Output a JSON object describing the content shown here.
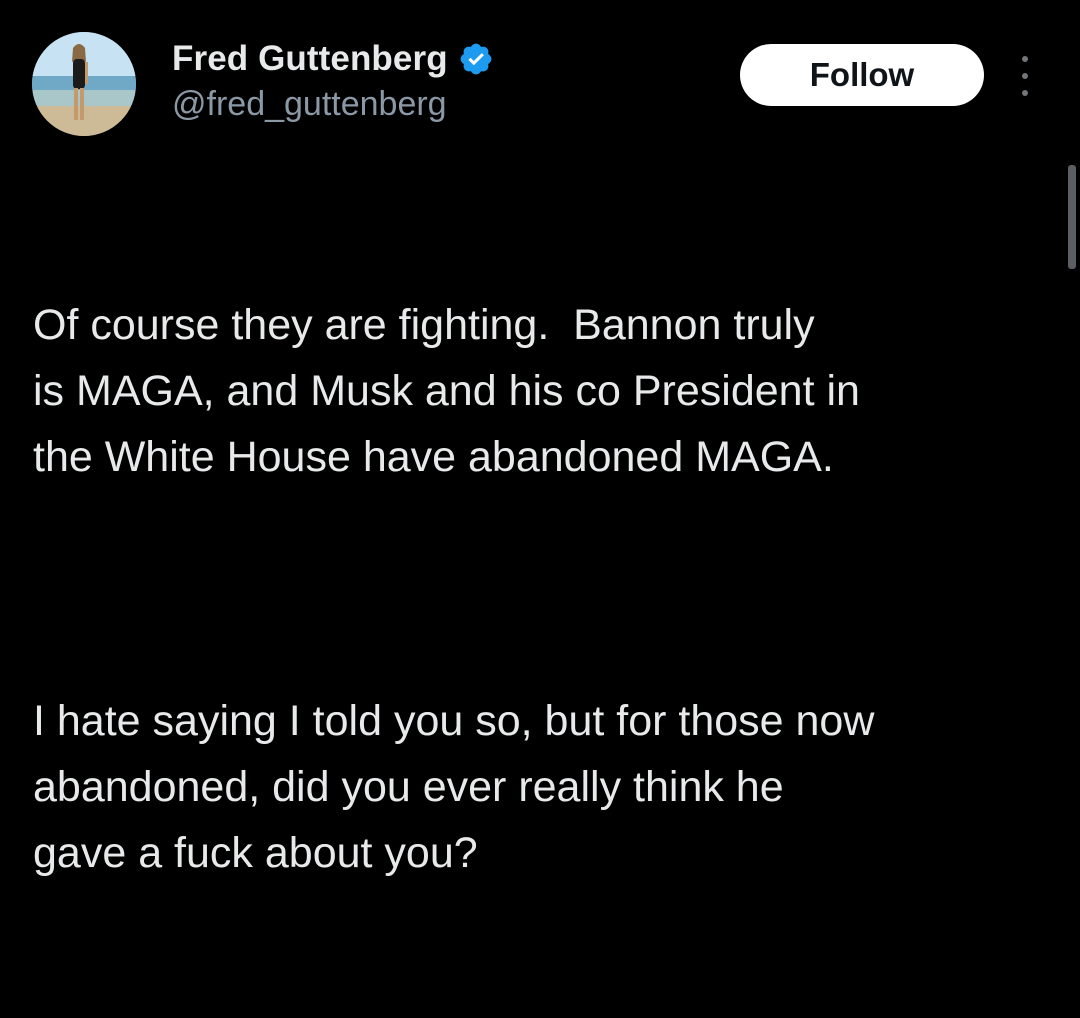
{
  "author": {
    "display_name": "Fred Guttenberg",
    "handle": "@fred_guttenberg",
    "verified": true
  },
  "actions": {
    "follow_label": "Follow",
    "more_icon": "more-vertical-icon"
  },
  "post": {
    "paragraphs": [
      "Of course they are fighting.  Bannon truly\nis MAGA, and Musk and his co President in\nthe White House have abandoned MAGA.",
      "I hate saying I told you so, but for those now\nabandoned, did you ever really think he\ngave a fuck about you?"
    ]
  },
  "colors": {
    "background": "#000000",
    "text": "#e7e9ea",
    "secondary_text": "#8b98a5",
    "verified_blue": "#1d9bf0",
    "follow_bg": "#ffffff"
  }
}
